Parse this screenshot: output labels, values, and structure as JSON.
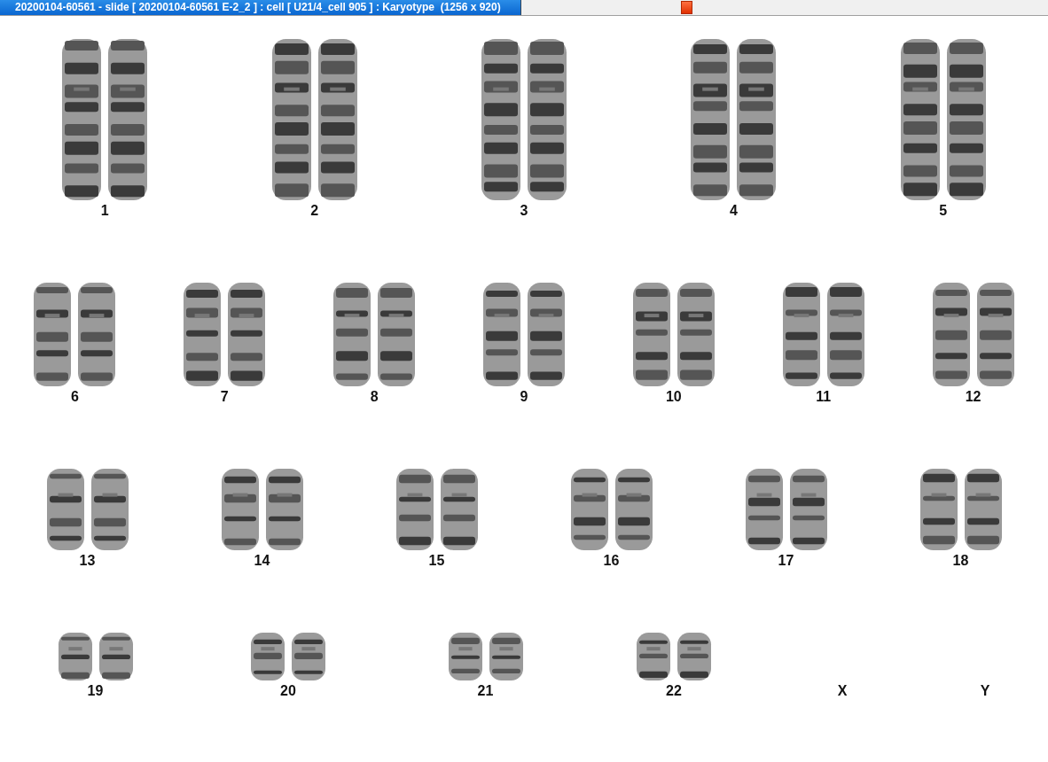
{
  "window": {
    "title": "20200104-60561 - slide [ 20200104-60561 E-2_2 ] : cell [ U21/4_cell 905 ] : Karyotype  (1256 x 920)"
  },
  "rows": [
    {
      "items": [
        {
          "label": "1",
          "kind": "pair"
        },
        {
          "label": "2",
          "kind": "pair"
        },
        {
          "label": "3",
          "kind": "pair"
        },
        {
          "label": "4",
          "kind": "pair"
        },
        {
          "label": "5",
          "kind": "pair"
        }
      ]
    },
    {
      "items": [
        {
          "label": "6",
          "kind": "pair"
        },
        {
          "label": "7",
          "kind": "pair"
        },
        {
          "label": "8",
          "kind": "pair"
        },
        {
          "label": "9",
          "kind": "pair"
        },
        {
          "label": "10",
          "kind": "pair"
        },
        {
          "label": "11",
          "kind": "pair"
        },
        {
          "label": "12",
          "kind": "pair"
        }
      ]
    },
    {
      "items": [
        {
          "label": "13",
          "kind": "pair"
        },
        {
          "label": "14",
          "kind": "pair"
        },
        {
          "label": "15",
          "kind": "pair"
        },
        {
          "label": "16",
          "kind": "pair"
        },
        {
          "label": "17",
          "kind": "pair"
        },
        {
          "label": "18",
          "kind": "pair"
        }
      ]
    },
    {
      "items": [
        {
          "label": "19",
          "kind": "pair"
        },
        {
          "label": "20",
          "kind": "pair"
        },
        {
          "label": "21",
          "kind": "pair"
        },
        {
          "label": "22",
          "kind": "pair"
        },
        {
          "label": "X",
          "kind": "empty"
        },
        {
          "label": "Y",
          "kind": "empty"
        }
      ]
    }
  ]
}
